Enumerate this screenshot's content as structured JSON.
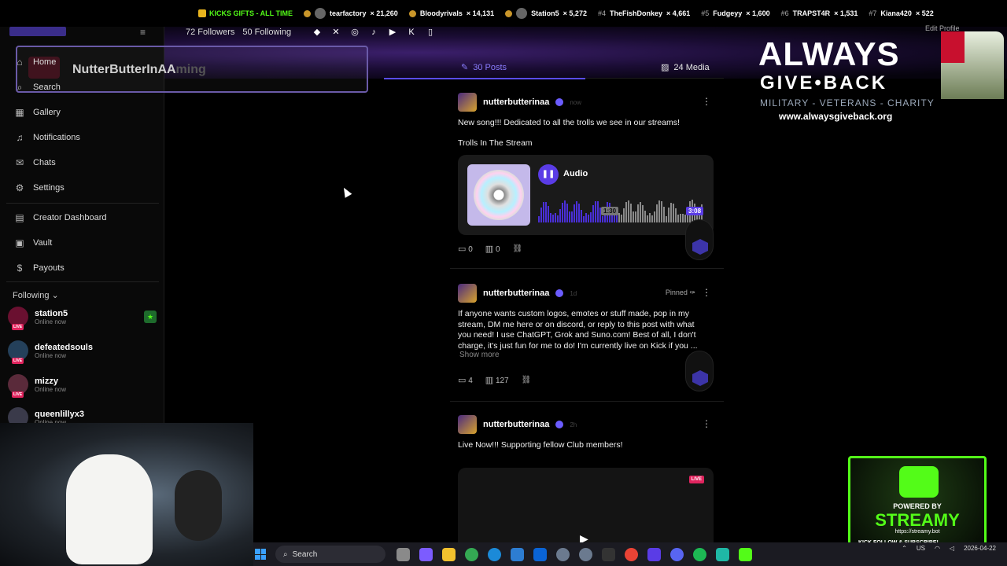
{
  "ticker": {
    "headline": "KICKS GIFTS - ALL TIME",
    "entries": [
      {
        "rank": "",
        "name": "tearfactory",
        "count": "× 21,260"
      },
      {
        "rank": "",
        "name": "Bloodyrivals",
        "count": "× 14,131"
      },
      {
        "rank": "",
        "name": "Station5",
        "count": "× 5,272"
      },
      {
        "rank": "#4",
        "name": "TheFishDonkey",
        "count": "× 4,661"
      },
      {
        "rank": "#5",
        "name": "Fudgeyy",
        "count": "× 1,600"
      },
      {
        "rank": "#6",
        "name": "TRAPST4R",
        "count": "× 1,531"
      },
      {
        "rank": "#7",
        "name": "Kiana420",
        "count": "× 522"
      }
    ]
  },
  "profile": {
    "followers": "72 Followers",
    "following": "50 Following",
    "overlay_name": "NutterButterInAA",
    "overlay_ghost": "ming",
    "edit_profile": "Edit Profile"
  },
  "sidebar": {
    "items": [
      {
        "label": "Home",
        "icon": "home-icon",
        "glyph": "⌂"
      },
      {
        "label": "Search",
        "icon": "search-icon",
        "glyph": "⌕"
      },
      {
        "label": "Gallery",
        "icon": "gallery-icon",
        "glyph": "▦"
      },
      {
        "label": "Notifications",
        "icon": "bell-icon",
        "glyph": "♫"
      },
      {
        "label": "Chats",
        "icon": "chat-icon",
        "glyph": "✉"
      },
      {
        "label": "Settings",
        "icon": "gear-icon",
        "glyph": "⚙"
      },
      {
        "label": "Creator Dashboard",
        "icon": "dashboard-icon",
        "glyph": "▤"
      },
      {
        "label": "Vault",
        "icon": "vault-icon",
        "glyph": "▣"
      },
      {
        "label": "Payouts",
        "icon": "dollar-icon",
        "glyph": "$"
      }
    ],
    "following_header": "Following",
    "following": [
      {
        "name": "station5",
        "status": "Online now"
      },
      {
        "name": "defeatedsouls",
        "status": "Online now"
      },
      {
        "name": "mizzy",
        "status": "Online now"
      },
      {
        "name": "queenlillyx3",
        "status": "Online now"
      }
    ]
  },
  "tabs": {
    "posts": "30 Posts",
    "media": "24 Media"
  },
  "posts": [
    {
      "author": "nutterbutterinaa",
      "time": "now",
      "text1": "New song!!! Dedicated to all the trolls we see in our streams!",
      "text2": "Trolls In The Stream",
      "audio_label": "Audio",
      "audio_current": "1:30",
      "audio_total": "3:08",
      "comments": "0",
      "views": "0"
    },
    {
      "author": "nutterbutterinaa",
      "time": "1d",
      "pinned": "Pinned",
      "text": "If anyone wants custom logos, emotes or stuff made, pop in my stream, DM me here or on discord, or reply to this post with what you need!  I use ChatGPT, Grok and Suno.com!  Best of all, I don't charge, it's just fun for me to do! I'm currently live on Kick if you ...",
      "show_more": "Show more",
      "comments": "4",
      "views": "127"
    },
    {
      "author": "nutterbutterinaa",
      "time": "2h",
      "text": "Live Now!!! Supporting fellow Club members!",
      "live": "LIVE"
    }
  ],
  "promo": {
    "line1": "ALWAYS",
    "line2": "GIVE•BACK",
    "tagline": "MILITARY - VETERANS - CHARITY",
    "url": "www.alwaysgiveback.org"
  },
  "streamy": {
    "powered": "POWERED BY",
    "name": "STREAMY",
    "url": "https://streamy.bot",
    "follow": "KICK  FOLLOW & SUBSCRIBE!"
  },
  "taskbar": {
    "search": "Search",
    "lang": "US",
    "clock_time": "",
    "clock_date": "2026-04-22"
  },
  "colors": {
    "accent": "#5a4cff",
    "kick_green": "#53fc18",
    "live_red": "#e0245e"
  }
}
